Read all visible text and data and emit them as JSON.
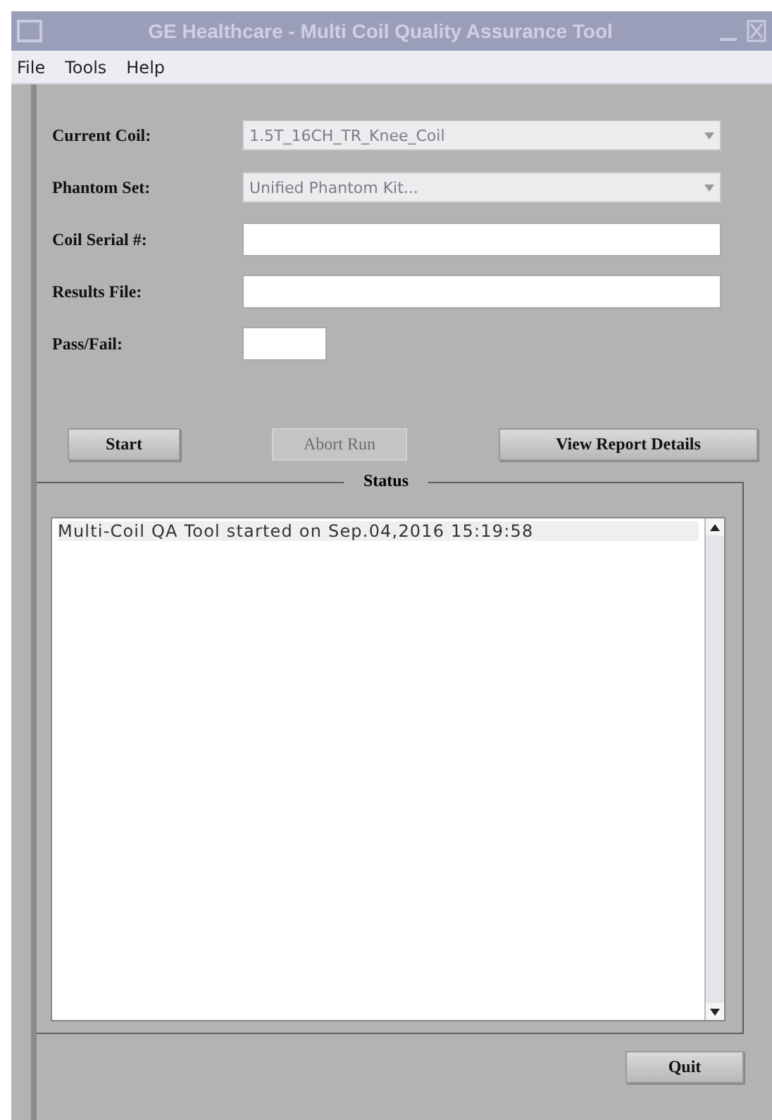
{
  "window": {
    "title": "GE Healthcare - Multi Coil Quality Assurance Tool"
  },
  "menu": [
    "File",
    "Tools",
    "Help"
  ],
  "form": [
    {
      "kind": "combo",
      "label": "Current Coil:",
      "value": "1.5T_16CH_TR_Knee_Coil",
      "disabled": true
    },
    {
      "kind": "combo",
      "label": "Phantom Set:",
      "value": "Unified Phantom Kit...",
      "disabled": true
    },
    {
      "kind": "text",
      "label": "Coil Serial #:"
    },
    {
      "kind": "text",
      "label": "Results File:"
    },
    {
      "kind": "short",
      "label": "Pass/Fail:"
    }
  ],
  "buttons": [
    {
      "label": "Start",
      "disabled": false
    },
    {
      "label": "Abort Run",
      "disabled": true
    },
    {
      "label": "View Report Details",
      "disabled": false
    }
  ],
  "status": {
    "title": "Status",
    "lines": [
      "Multi-Coil QA Tool started on Sep.04,2016 15:19:58"
    ]
  },
  "footer_buttons": [
    {
      "label": "Quit",
      "disabled": false
    }
  ]
}
